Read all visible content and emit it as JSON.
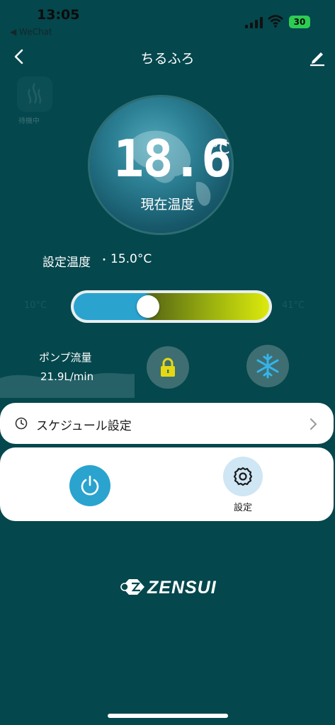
{
  "status_bar": {
    "time": "13:05",
    "back_app": "◀ WeChat",
    "battery": "30"
  },
  "header": {
    "title": "ちるふろ"
  },
  "ghost_label": "待機中",
  "current_temp": {
    "value": "18.6",
    "unit": "°C",
    "label": "現在温度"
  },
  "set_temp": {
    "label": "設定温度",
    "separator": "・",
    "value": "15.0°C"
  },
  "slider": {
    "min_label": "10°C",
    "max_label": "41°C",
    "position_fraction": 0.38
  },
  "pump": {
    "label": "ポンプ流量",
    "value": "21.9L/min"
  },
  "schedule": {
    "label": "スケジュール設定"
  },
  "controls": {
    "settings_label": "設定"
  },
  "logo": {
    "text": "ZENSUI"
  },
  "colors": {
    "background": "#04474d",
    "accent_blue": "#2aa3cf",
    "lock_yellow": "#e5d812",
    "snow_blue": "#36b4ea"
  },
  "icons": [
    "back-icon",
    "edit-icon",
    "lock-icon",
    "snowflake-icon",
    "clock-icon",
    "chevron-right-icon",
    "power-icon",
    "gear-icon"
  ]
}
